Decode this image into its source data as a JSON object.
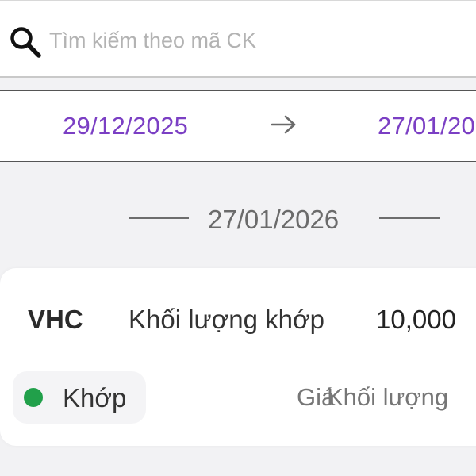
{
  "search": {
    "placeholder": "Tìm kiếm theo mã CK",
    "icon": "search-icon"
  },
  "date_range": {
    "from": "29/12/2025",
    "to": "27/01/20",
    "arrow_icon": "arrow-right-icon",
    "color": "#7b3fc4"
  },
  "day_group": {
    "date": "27/01/2026"
  },
  "order": {
    "symbol": "VHC",
    "quantity_label": "Khối lượng khớp",
    "quantity_value": "10,000",
    "status": "Khớp",
    "status_color": "#21a04a",
    "price_label": "Giá",
    "volume_label": "Khối lượng"
  }
}
